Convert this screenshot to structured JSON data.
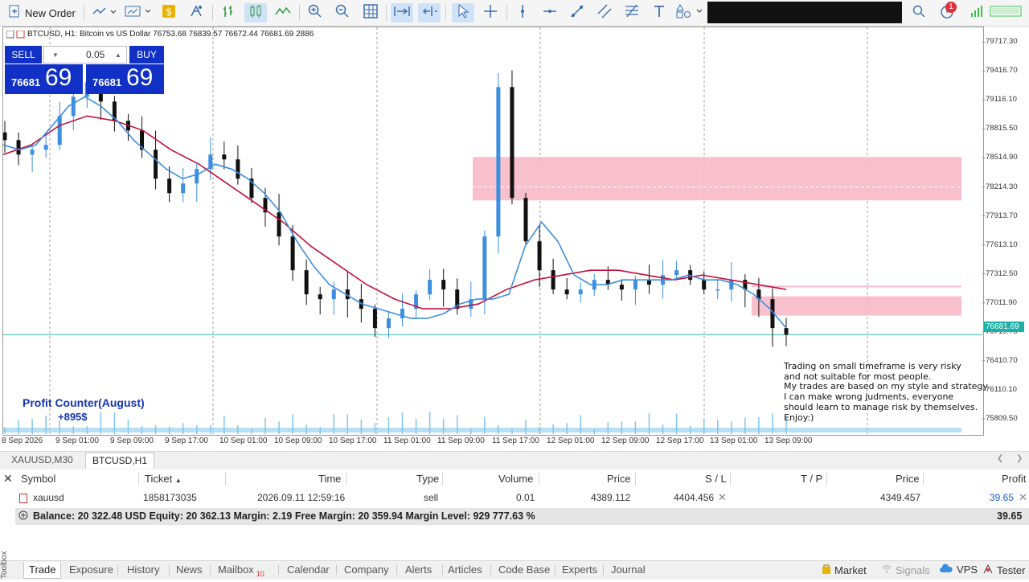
{
  "toolbar": {
    "new_order_label": "New Order",
    "notification_count": "1",
    "icons": [
      "new-order-icon",
      "chart-type-icon",
      "chart-templates-icon",
      "algo-trading-icon",
      "auto-trading-icon",
      "bar-chart-icon",
      "candlestick-icon",
      "line-chart-icon",
      "zoom-in-icon",
      "zoom-out-icon",
      "grid-icon",
      "autoscroll-icon",
      "chart-shift-icon",
      "cursor-icon",
      "crosshair-icon",
      "vertical-line-icon",
      "horizontal-line-icon",
      "trendline-icon",
      "channel-icon",
      "fibonacci-icon",
      "text-icon",
      "shapes-icon",
      "search-icon",
      "notifications-icon",
      "signal-strength-icon",
      "battery-icon"
    ]
  },
  "chart": {
    "title": "BTCUSD, H1:  Bitcoin vs US Dollar  76753.68 76839.57 76672.44 76681.69  2886",
    "sell_label": "SELL",
    "buy_label": "BUY",
    "lot_value": "0.05",
    "sell_price_small": "76681",
    "sell_price_big": "69",
    "buy_price_small": "76681",
    "buy_price_big": "69",
    "profit_counter_label": "Profit Counter(August)",
    "profit_counter_value": "+895$",
    "note": "Trading on small timeframe is very risky\nand not suitable for most people.\nMy trades are based on my style and strategy.\nI can make wrong judments, everyone\nshould learn to manage risk by themselves.\nEnjoy:)",
    "current_price": "76681.69",
    "colors": {
      "bull": "#3d8fe0",
      "bear": "#111111",
      "ma_slow": "#c0103e",
      "ma_fast": "#3d8fe0",
      "zone": "#f7b8c8",
      "current_line": "#1bb1a6",
      "volume": "#7ec7ec"
    }
  },
  "chart_data": {
    "type": "candlestick",
    "symbol": "BTCUSD",
    "timeframe": "H1",
    "ylim": [
      75650,
      79870
    ],
    "y_ticks": [
      "79717.30",
      "79416.70",
      "79116.10",
      "78815.50",
      "78514.90",
      "78214.30",
      "77913.70",
      "77613.10",
      "77312.50",
      "77011.90",
      "76710.70",
      "76410.70",
      "76110.10",
      "75809.50"
    ],
    "x_ticks": [
      "8 Sep 2026",
      "9 Sep 01:00",
      "9 Sep 09:00",
      "9 Sep 17:00",
      "10 Sep 01:00",
      "10 Sep 09:00",
      "10 Sep 17:00",
      "11 Sep 01:00",
      "11 Sep 09:00",
      "11 Sep 17:00",
      "12 Sep 01:00",
      "12 Sep 09:00",
      "12 Sep 17:00",
      "13 Sep 01:00",
      "13 Sep 09:00"
    ],
    "close_path": [
      78700,
      78550,
      78600,
      78650,
      78950,
      79150,
      79300,
      79100,
      78900,
      78800,
      78600,
      78300,
      78150,
      78250,
      78400,
      78550,
      78500,
      78300,
      78100,
      77950,
      77700,
      77350,
      77100,
      77050,
      77150,
      77050,
      76950,
      76750,
      76850,
      76950,
      77100,
      77250,
      77150,
      76950,
      77050,
      77700,
      79250,
      78100,
      77650,
      77350,
      77150,
      77100,
      77150,
      77250,
      77200,
      77150,
      77250,
      77200,
      77300,
      77350,
      77250,
      77150,
      77150,
      77250,
      77150,
      77050,
      76750,
      76681.69
    ],
    "ma_fast_path": [
      78650,
      78600,
      78650,
      78850,
      79050,
      79150,
      79050,
      78900,
      78700,
      78550,
      78400,
      78300,
      78350,
      78450,
      78400,
      78300,
      78150,
      77950,
      77650,
      77400,
      77200,
      77100,
      77000,
      76950,
      76900,
      76850,
      76850,
      76900,
      77000,
      77050,
      77050,
      77100,
      77600,
      77850,
      77650,
      77300,
      77200,
      77200,
      77250,
      77250,
      77250,
      77250,
      77300,
      77250,
      77250,
      77200,
      77100,
      76950,
      76750
    ],
    "ma_slow_path": [
      78550,
      78650,
      78850,
      78950,
      78900,
      78800,
      78600,
      78450,
      78250,
      78050,
      77850,
      77600,
      77400,
      77200,
      77050,
      76950,
      76950,
      77000,
      77150,
      77250,
      77300,
      77350,
      77350,
      77300,
      77250,
      77300,
      77250,
      77200,
      77150
    ],
    "zones": [
      {
        "from": 78075,
        "to": 78525
      },
      {
        "from": 76880,
        "to": 77080
      },
      {
        "from": 77180,
        "to": 77190
      }
    ]
  },
  "chart_tabs": [
    "XAUUSD,M30",
    "BTCUSD,H1"
  ],
  "terminal": {
    "headers": {
      "symbol": "Symbol",
      "ticket": "Ticket",
      "time": "Time",
      "type": "Type",
      "volume": "Volume",
      "price": "Price",
      "sl": "S / L",
      "tp": "T / P",
      "price2": "Price",
      "profit": "Profit"
    },
    "row": {
      "symbol": "xauusd",
      "ticket": "1858173035",
      "time": "2026.09.11 12:59:16",
      "type": "sell",
      "volume": "0.01",
      "price": "4389.112",
      "sl": "4404.456",
      "tp": "",
      "price2": "4349.457",
      "profit": "39.65"
    },
    "balance_line": "Balance: 20 322.48 USD  Equity: 20 362.13  Margin: 2.19  Free Margin: 20 359.94  Margin Level: 929 777.63 %",
    "balance_profit": "39.65"
  },
  "bottom_tabs": [
    {
      "label": "Trade"
    },
    {
      "label": "Exposure"
    },
    {
      "label": "History"
    },
    {
      "label": "News"
    },
    {
      "label": "Mailbox",
      "badge": "10"
    },
    {
      "label": "Calendar"
    },
    {
      "label": "Company"
    },
    {
      "label": "Alerts"
    },
    {
      "label": "Articles"
    },
    {
      "label": "Code Base"
    },
    {
      "label": "Experts"
    },
    {
      "label": "Journal"
    }
  ],
  "toolbox_label": "Toolbox",
  "status_right": {
    "market": "Market",
    "signals": "Signals",
    "vps": "VPS",
    "tester": "Tester"
  }
}
